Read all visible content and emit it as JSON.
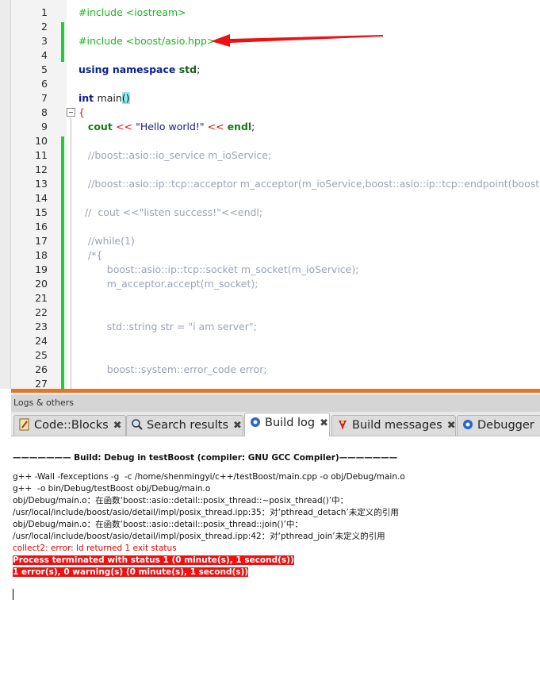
{
  "editor": {
    "lines": [
      {
        "n": "1",
        "parts": [
          {
            "c": "pp",
            "t": "#include <iostream>"
          }
        ]
      },
      {
        "n": "2",
        "parts": []
      },
      {
        "n": "3",
        "parts": [
          {
            "c": "pp",
            "t": "#include <boost/asio.hpp>"
          }
        ]
      },
      {
        "n": "4",
        "parts": []
      },
      {
        "n": "5",
        "parts": [
          {
            "c": "kw",
            "t": "using namespace "
          },
          {
            "c": "std",
            "t": "std"
          },
          {
            "c": "plain",
            "t": ";"
          }
        ]
      },
      {
        "n": "6",
        "parts": []
      },
      {
        "n": "7",
        "parts": [
          {
            "c": "kw",
            "t": "int "
          },
          {
            "c": "plain",
            "t": "main"
          },
          {
            "c": "brk",
            "t": "()"
          }
        ]
      },
      {
        "n": "8",
        "parts": [
          {
            "c": "redbrace",
            "t": "{"
          }
        ]
      },
      {
        "n": "9",
        "parts": [
          {
            "c": "plain",
            "t": "   "
          },
          {
            "c": "cout",
            "t": "cout "
          },
          {
            "c": "op",
            "t": "<< "
          },
          {
            "c": "str",
            "t": "\"Hello world!\" "
          },
          {
            "c": "op",
            "t": "<< "
          },
          {
            "c": "cout",
            "t": "endl"
          },
          {
            "c": "plain",
            "t": ";"
          }
        ]
      },
      {
        "n": "10",
        "parts": []
      },
      {
        "n": "11",
        "parts": [
          {
            "c": "cm",
            "t": "   //boost::asio::io_service m_ioService;"
          }
        ]
      },
      {
        "n": "12",
        "parts": []
      },
      {
        "n": "13",
        "parts": [
          {
            "c": "cm",
            "t": "   //boost::asio::ip::tcp::acceptor m_acceptor(m_ioService,boost::asio::ip::tcp::endpoint(boost::asi"
          }
        ]
      },
      {
        "n": "14",
        "parts": []
      },
      {
        "n": "15",
        "parts": [
          {
            "c": "cm",
            "t": "  //  cout <<\"listen success!\"<<endl;"
          }
        ]
      },
      {
        "n": "16",
        "parts": []
      },
      {
        "n": "17",
        "parts": [
          {
            "c": "cm",
            "t": "   //while(1)"
          }
        ]
      },
      {
        "n": "18",
        "parts": [
          {
            "c": "cm",
            "t": "   /*{"
          }
        ]
      },
      {
        "n": "19",
        "parts": [
          {
            "c": "cm",
            "t": "         boost::asio::ip::tcp::socket m_socket(m_ioService);"
          }
        ]
      },
      {
        "n": "20",
        "parts": [
          {
            "c": "cm",
            "t": "         m_acceptor.accept(m_socket);"
          }
        ]
      },
      {
        "n": "21",
        "parts": []
      },
      {
        "n": "22",
        "parts": []
      },
      {
        "n": "23",
        "parts": [
          {
            "c": "cm",
            "t": "         std::string str = \"i am server\";"
          }
        ]
      },
      {
        "n": "24",
        "parts": []
      },
      {
        "n": "25",
        "parts": []
      },
      {
        "n": "26",
        "parts": [
          {
            "c": "cm",
            "t": "         boost::system::error_code error;"
          }
        ]
      },
      {
        "n": "27",
        "parts": []
      }
    ]
  },
  "logs_panel": {
    "title": "Logs & others",
    "tabs": [
      {
        "label": "Code::Blocks",
        "icon": "document-icon"
      },
      {
        "label": "Search results",
        "icon": "magnifier-icon"
      },
      {
        "label": "Build log",
        "icon": "gear-icon",
        "active": true
      },
      {
        "label": "Build messages",
        "icon": "pin-icon"
      },
      {
        "label": "Debugger",
        "icon": "gear-icon"
      }
    ],
    "close_glyph": "✖"
  },
  "build_log": {
    "header": "——————— Build: Debug in testBoost (compiler: GNU GCC Compiler)———————",
    "lines": [
      {
        "style": "black",
        "t": "g++ -Wall -fexceptions -g  -c /home/shenmingyi/c++/testBoost/main.cpp -o obj/Debug/main.o"
      },
      {
        "style": "black",
        "t": "g++  -o bin/Debug/testBoost obj/Debug/main.o"
      },
      {
        "style": "black",
        "t": "obj/Debug/main.o：在函数‘boost::asio::detail::posix_thread::~posix_thread()’中："
      },
      {
        "style": "black",
        "t": "/usr/local/include/boost/asio/detail/impl/posix_thread.ipp:35：对‘pthread_detach’未定义的引用"
      },
      {
        "style": "black",
        "t": "obj/Debug/main.o：在函数‘boost::asio::detail::posix_thread::join()’中："
      },
      {
        "style": "black",
        "t": "/usr/local/include/boost/asio/detail/impl/posix_thread.ipp:42：对‘pthread_join’未定义的引用"
      },
      {
        "style": "red",
        "t": "collect2: error: ld returned 1 exit status"
      },
      {
        "style": "hl",
        "t": "Process terminated with status 1 (0 minute(s), 1 second(s))"
      },
      {
        "style": "hl",
        "t": "1 error(s), 0 warning(s) (0 minute(s), 1 second(s))"
      }
    ]
  },
  "annotations": {
    "arrow_color": "#ee1111",
    "circle_color": "#ee1111"
  }
}
